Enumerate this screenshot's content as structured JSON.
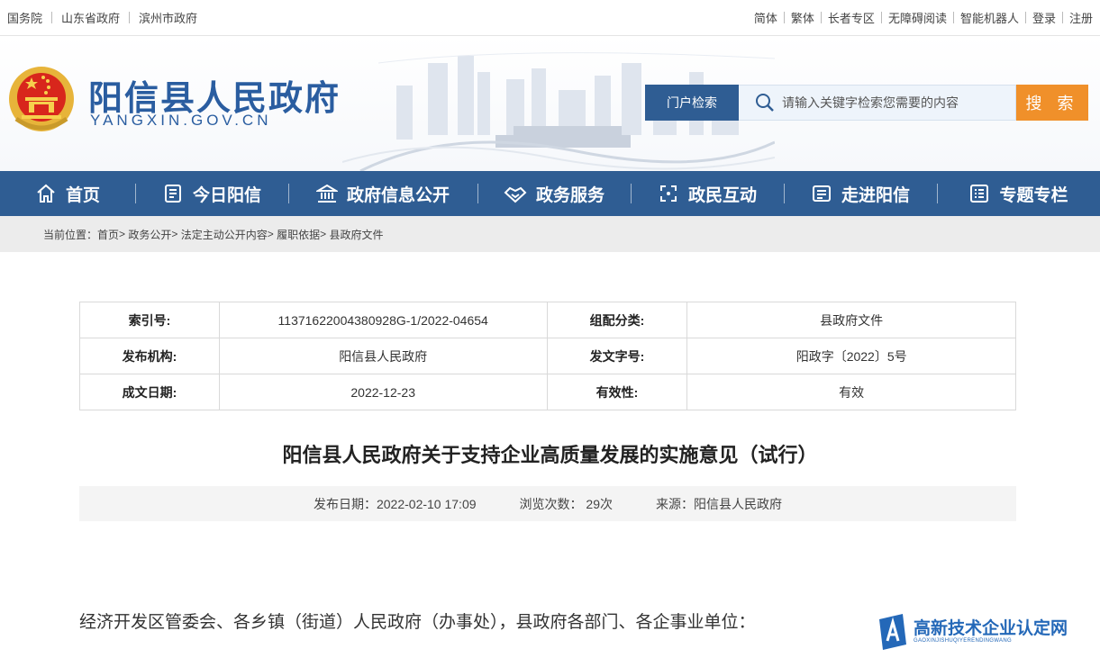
{
  "topbar": {
    "left_links": [
      "国务院",
      "山东省政府",
      "滨州市政府"
    ],
    "right_links": [
      "简体",
      "繁体",
      "长者专区",
      "无障碍阅读",
      "智能机器人",
      "登录",
      "注册"
    ]
  },
  "header": {
    "title": "阳信县人民政府",
    "subtitle": "YANGXIN.GOV.CN",
    "portal_search_label": "门户检索",
    "search_placeholder": "请输入关键字检索您需要的内容",
    "search_button": "搜 索"
  },
  "nav": [
    {
      "label": "首页",
      "icon": "home-icon"
    },
    {
      "label": "今日阳信",
      "icon": "newspaper-icon"
    },
    {
      "label": "政府信息公开",
      "icon": "government-building-icon"
    },
    {
      "label": "政务服务",
      "icon": "handshake-icon"
    },
    {
      "label": "政民互动",
      "icon": "interaction-icon"
    },
    {
      "label": "走进阳信",
      "icon": "id-card-icon"
    },
    {
      "label": "专题专栏",
      "icon": "list-icon"
    }
  ],
  "breadcrumb": {
    "prefix": "当前位置：",
    "items": [
      "首页",
      "政务公开",
      "法定主动公开内容",
      "履职依据",
      "县政府文件"
    ]
  },
  "info_table": {
    "rows": [
      {
        "k1": "索引号:",
        "v1": "11371622004380928G-1/2022-04654",
        "k2": "组配分类:",
        "v2": "县政府文件"
      },
      {
        "k1": "发布机构:",
        "v1": "阳信县人民政府",
        "k2": "发文字号:",
        "v2": "阳政字〔2022〕5号"
      },
      {
        "k1": "成文日期:",
        "v1": "2022-12-23",
        "k2": "有效性:",
        "v2": "有效"
      }
    ]
  },
  "document": {
    "title": "阳信县人民政府关于支持企业高质量发展的实施意见（试行）",
    "publish_date": "发布日期：2022-02-10 17:09",
    "views": "浏览次数： 29次",
    "source": "来源：阳信县人民政府",
    "first_line": "经济开发区管委会、各乡镇（街道）人民政府（办事处），县政府各部门、各企事业单位："
  },
  "watermark": {
    "main": "高新技术企业认定网",
    "sub": "GAOXINJISHUQIYERENDINGWANG"
  },
  "colors": {
    "primary": "#2f5d93",
    "accent": "#f0902a",
    "title_blue": "#2a5da0"
  }
}
